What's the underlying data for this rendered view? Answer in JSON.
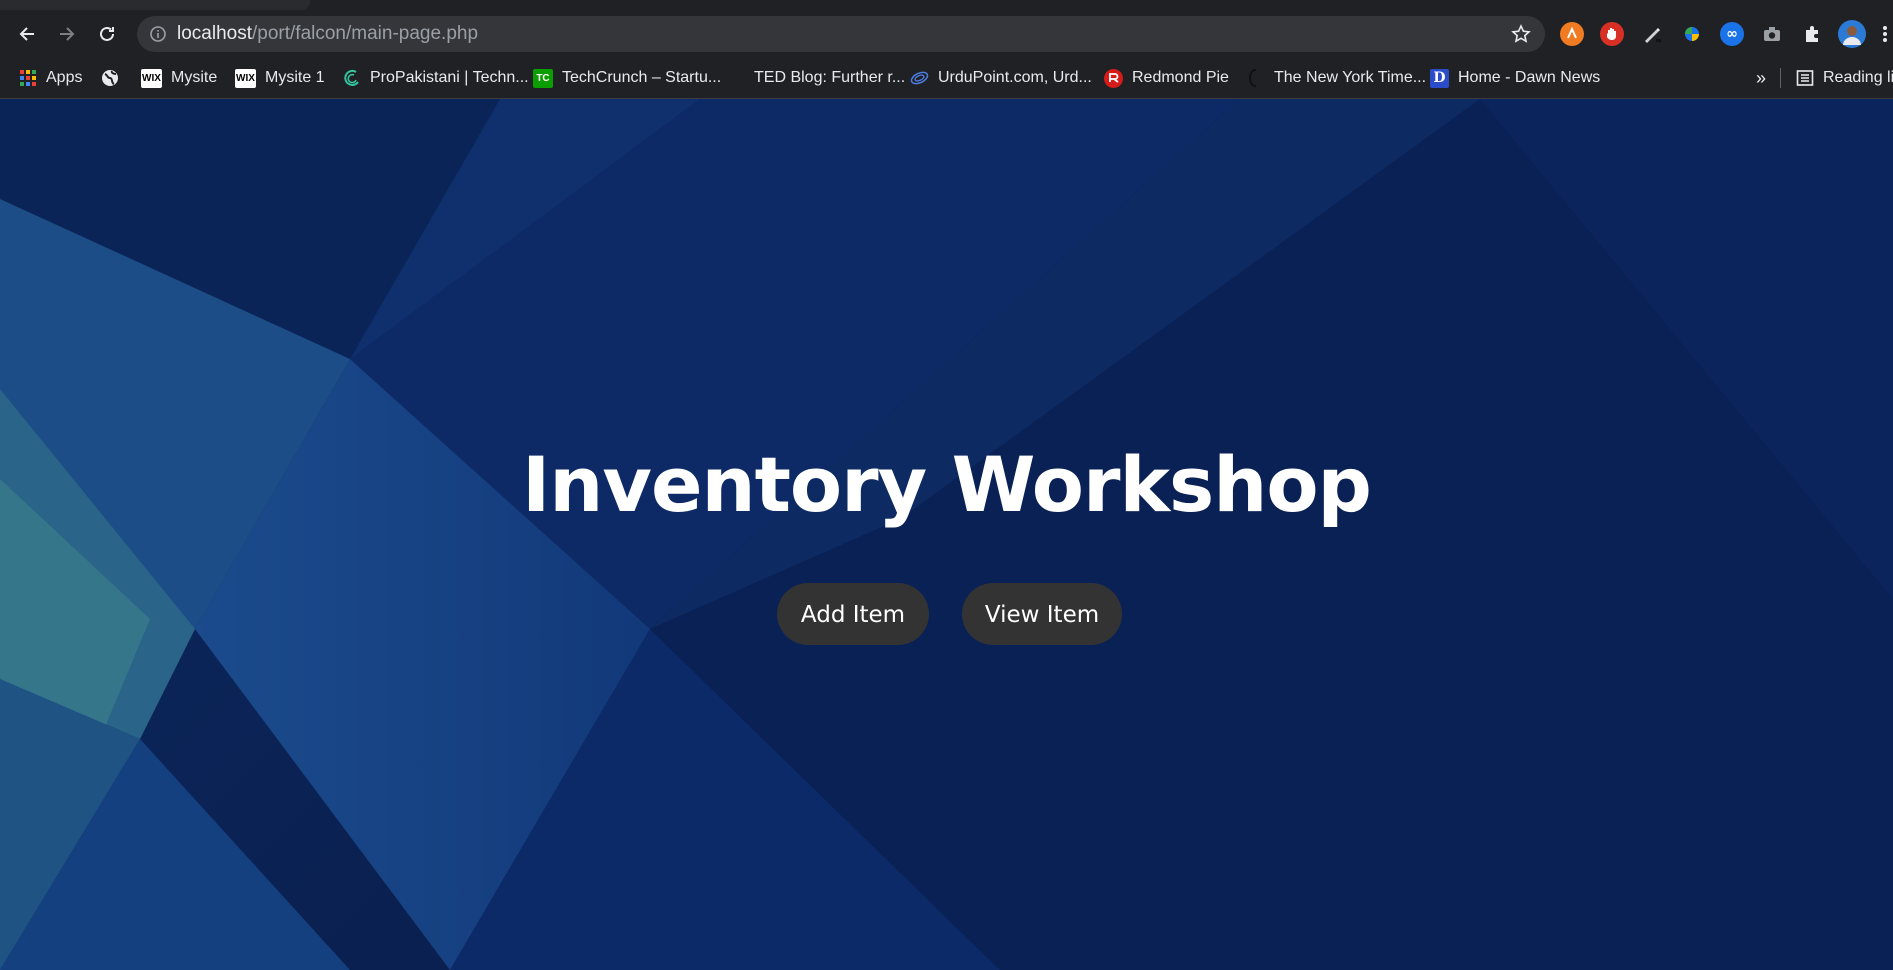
{
  "browser": {
    "url_host": "localhost",
    "url_path": "/port/falcon/main-page.php",
    "bookmarks": [
      {
        "label": "Apps",
        "icon": "apps-grid-icon"
      },
      {
        "label": "",
        "icon": "globe-icon"
      },
      {
        "label": "Mysite",
        "icon": "wix-icon"
      },
      {
        "label": "Mysite 1",
        "icon": "wix-icon"
      },
      {
        "label": "ProPakistani | Techn...",
        "icon": "propakistani-icon"
      },
      {
        "label": "TechCrunch – Startu...",
        "icon": "techcrunch-icon"
      },
      {
        "label": "TED Blog: Further r...",
        "icon": "ted-icon"
      },
      {
        "label": "UrduPoint.com, Urd...",
        "icon": "urdupoint-icon"
      },
      {
        "label": "Redmond Pie",
        "icon": "redmondpie-icon"
      },
      {
        "label": "The New York Time...",
        "icon": "nytimes-icon"
      },
      {
        "label": "Home - Dawn News",
        "icon": "dawn-icon"
      }
    ],
    "overflow": "»",
    "reading_list": "Reading list",
    "wix_badge": "WIX",
    "techcrunch_badge": "TC",
    "dawn_badge": "D"
  },
  "hero": {
    "title": "Inventory Workshop",
    "add_button": "Add Item",
    "view_button": "View Item"
  },
  "colors": {
    "chrome_bg": "#202124",
    "omnibox_bg": "#35363a",
    "button_bg": "#333333",
    "page_bg": "#0b2358"
  }
}
